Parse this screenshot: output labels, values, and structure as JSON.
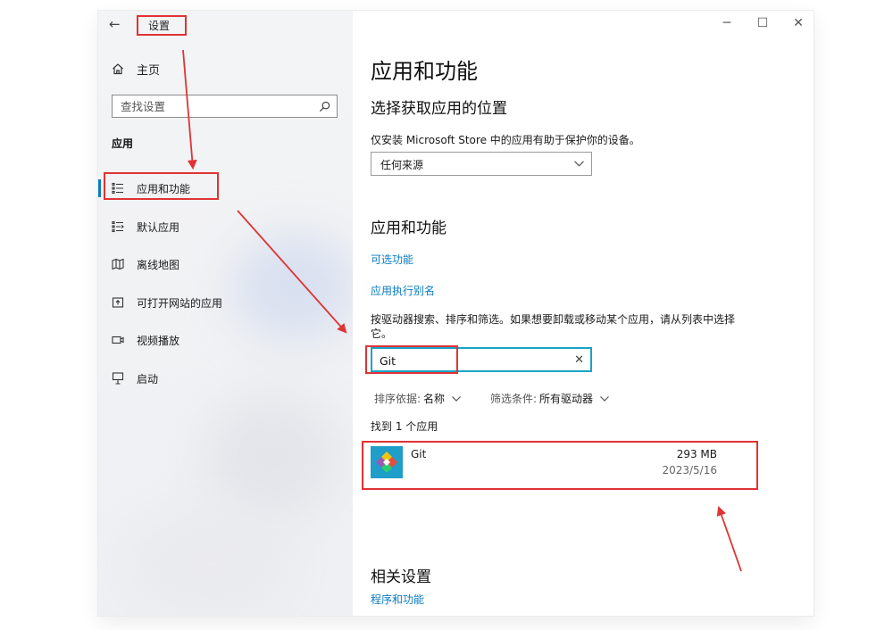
{
  "window": {
    "title": "设置",
    "back_icon": "back-arrow-icon",
    "controls": {
      "minimize": "─",
      "maximize": "☐",
      "close": "✕"
    }
  },
  "sidebar": {
    "home_label": "主页",
    "search_placeholder": "查找设置",
    "section_label": "应用",
    "items": [
      {
        "label": "应用和功能",
        "icon": "apps-features-icon",
        "selected": true
      },
      {
        "label": "默认应用",
        "icon": "default-apps-icon",
        "selected": false
      },
      {
        "label": "离线地图",
        "icon": "offline-maps-icon",
        "selected": false
      },
      {
        "label": "可打开网站的应用",
        "icon": "apps-for-websites-icon",
        "selected": false
      },
      {
        "label": "视频播放",
        "icon": "video-playback-icon",
        "selected": false
      },
      {
        "label": "启动",
        "icon": "startup-icon",
        "selected": false
      }
    ]
  },
  "main": {
    "page_title": "应用和功能",
    "install_section": {
      "heading": "选择获取应用的位置",
      "description": "仅安装 Microsoft Store 中的应用有助于保护你的设备。",
      "dropdown_value": "任何来源"
    },
    "apps_section": {
      "heading": "应用和功能",
      "links": [
        "可选功能",
        "应用执行别名"
      ],
      "search_description": "按驱动器搜索、排序和筛选。如果想要卸载或移动某个应用，请从列表中选择它。",
      "search_value": "Git",
      "sort_label": "排序依据:",
      "sort_value": "名称",
      "filter_label": "筛选条件:",
      "filter_value": "所有驱动器",
      "result_count": "找到 1 个应用",
      "apps": [
        {
          "name": "Git",
          "size": "293 MB",
          "date": "2023/5/16",
          "icon": "git-app-icon"
        }
      ]
    },
    "related_section": {
      "heading": "相关设置",
      "link": "程序和功能"
    }
  },
  "colors": {
    "accent": "#0a7cc1",
    "annotation": "#e03333",
    "search_focus_border": "#1aa3c7"
  }
}
